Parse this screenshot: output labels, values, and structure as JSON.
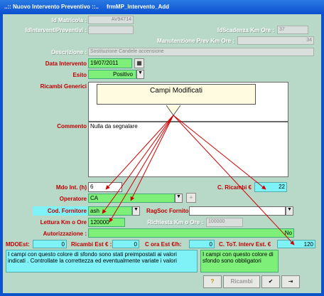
{
  "window": {
    "title": "..:: Nuovo Intervento Preventivo ::..     frmMP_Intervento_Add"
  },
  "fields": {
    "id_matricola": {
      "label": "Id Matricola :",
      "value": "AV94714"
    },
    "id_interventi_preventivi": {
      "label": "IdInterventiPreventivi :",
      "value": ""
    },
    "id_scadenza_km_ore": {
      "label": "IdScadenza Km Ore :",
      "value": "37"
    },
    "manutenzione_prev": {
      "label": "Manutenzione Prev Km Ore :",
      "value": "34"
    },
    "descrizione": {
      "label": "Descrizione :",
      "value": "Sostituzione Candele accensione"
    },
    "data_intervento": {
      "label": "Data Intervento",
      "value": "19/07/2011"
    },
    "esito": {
      "label": "Esito",
      "value": "Positivo"
    },
    "ricambi_generici": {
      "label": "Ricambi Generici"
    },
    "commento": {
      "label": "Commento",
      "value": "Nulla da segnalare"
    },
    "mdo_int": {
      "label": "Mdo Int. (h)",
      "value": "6"
    },
    "c_ricambi": {
      "label": "C. Ricambi €",
      "value": "22"
    },
    "operatore": {
      "label": "Operatore",
      "value": "CA"
    },
    "cod_fornitore": {
      "label": "Cod. Fornitore",
      "value": "ash"
    },
    "ragsoc_fornitore": {
      "label": "RagSoc Fornito",
      "value": ""
    },
    "lettura_km_ore": {
      "label": "Lettura Km o Ore",
      "value": "120000"
    },
    "richiesta_km_ore": {
      "label": "Richiesta Km o Ore :",
      "value": "100000"
    },
    "autorizzazione": {
      "label": "Autorizzazione :",
      "value": "No"
    },
    "mdo_est": {
      "label": "MDOEst:",
      "value": "0"
    },
    "ricambi_est": {
      "label": "Ricambi Est € :",
      "value": "0"
    },
    "c_ora_est": {
      "label": "C ora Est €/h:",
      "value": "0"
    },
    "c_tot_interv_est": {
      "label": "C. ToT. Interv Est. €",
      "value": "120"
    }
  },
  "note": {
    "text": "Campi Modificati"
  },
  "info": {
    "cyan": "I campi con questo colore di sfondo sono stati preimpostati ai valori indicati . Controllate la correttezza ed eventualmente variate i valori",
    "green": "I campi con questo colore di sfondo sono obbligatori"
  },
  "buttons": {
    "ricambi": "Ricambi",
    "add_plus": "+"
  }
}
